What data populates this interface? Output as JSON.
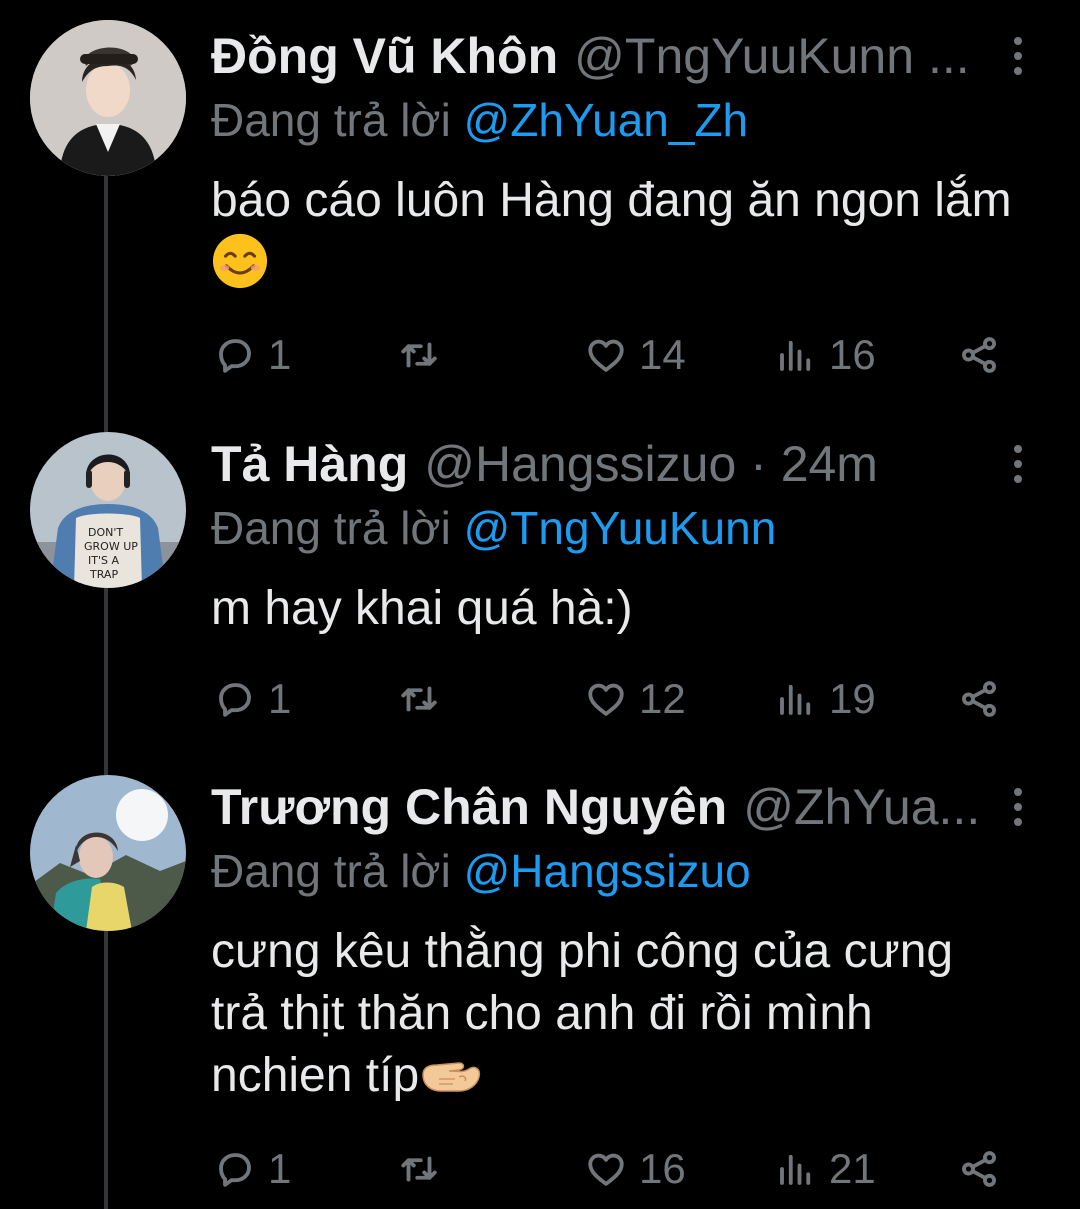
{
  "thread": {
    "tweets": [
      {
        "display_name": "Đồng Vũ Khôn",
        "handle": "@TngYuuKunn ...",
        "reply_prefix": "Đang trả lời",
        "reply_to": "@ZhYuan_Zh",
        "body": "báo cáo luôn Hàng đang ăn ngon lắm",
        "emoji": "smiling-face-emoji",
        "replies": "1",
        "likes": "14",
        "views": "16"
      },
      {
        "display_name": "Tả Hàng",
        "handle": "@Hangssizuo · 24m",
        "reply_prefix": "Đang trả lời",
        "reply_to": "@TngYuuKunn",
        "body": "m hay khai quá hà:)",
        "replies": "1",
        "likes": "12",
        "views": "19"
      },
      {
        "display_name": "Trương Chân Nguyên",
        "handle": "@ZhYua...",
        "reply_prefix": "Đang trả lời",
        "reply_to": "@Hangssizuo",
        "body": "cưng kêu thằng phi công của cưng trả thịt thăn cho anh đi rồi mình nchien típ",
        "emoji": "pinching-hand-emoji",
        "replies": "1",
        "likes": "16",
        "views": "21"
      }
    ]
  },
  "icons": {
    "reply": "reply-icon",
    "retweet": "retweet-icon",
    "like": "heart-icon",
    "views": "views-icon",
    "share": "share-icon",
    "more": "more-icon"
  },
  "colors": {
    "background": "#000000",
    "text": "#e7e9ea",
    "muted": "#71767b",
    "mention": "#1d9bf0"
  }
}
